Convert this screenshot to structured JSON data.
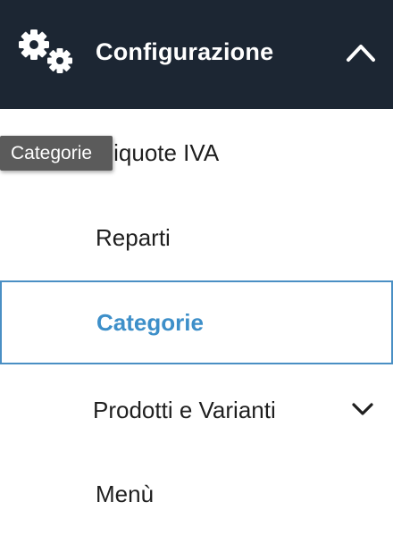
{
  "header": {
    "title": "Configurazione",
    "icon": "gears-icon",
    "toggle_icon": "chevron-up-icon",
    "background": "#1c2633"
  },
  "menu": {
    "items": [
      {
        "label": "Aliquote IVA",
        "active": false
      },
      {
        "label": "Reparti",
        "active": false
      },
      {
        "label": "Categorie",
        "active": true
      },
      {
        "label": "Prodotti e Varianti",
        "active": false,
        "expand_icon": "chevron-down-icon"
      },
      {
        "label": "Menù",
        "active": false
      }
    ]
  },
  "tooltip": {
    "text": "Categorie"
  },
  "colors": {
    "accent": "#3d8fc9",
    "text": "#1f1f1f",
    "tooltip_bg": "#5b5b5b"
  }
}
